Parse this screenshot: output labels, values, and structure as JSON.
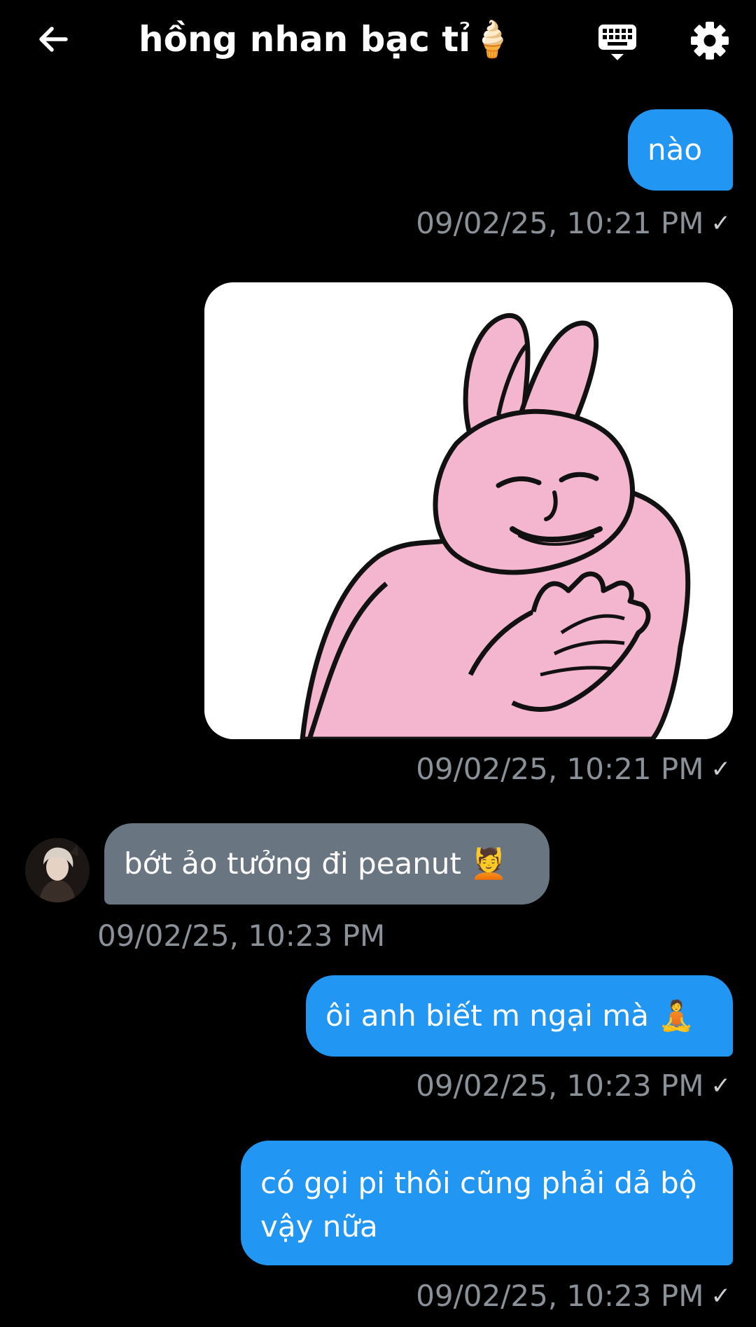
{
  "header": {
    "title": "hồng nhan bạc tỉ🍦",
    "back_icon": "arrow-left-icon",
    "keyboard_icon": "keyboard-icon",
    "settings_icon": "gear-icon"
  },
  "colors": {
    "background": "#000000",
    "outgoing_bubble": "#2196f3",
    "incoming_bubble": "#6a7582",
    "timestamp": "#8a9199"
  },
  "messages": [
    {
      "direction": "out",
      "type": "text",
      "text": "nào",
      "time": "09/02/25, 10:21 PM",
      "status": "✓"
    },
    {
      "direction": "out",
      "type": "image",
      "image": "pink-bunny-sticker",
      "time": "09/02/25, 10:21 PM",
      "status": "✓"
    },
    {
      "direction": "in",
      "type": "text",
      "text": "bớt ảo tưởng đi peanut 💆",
      "time": "09/02/25, 10:23 PM",
      "avatar": "contact-avatar"
    },
    {
      "direction": "out",
      "type": "text",
      "text": "ôi anh biết m ngại mà 🧘",
      "time": "09/02/25, 10:23 PM",
      "status": "✓"
    },
    {
      "direction": "out",
      "type": "text",
      "text": "có gọi pi thôi cũng phải dả bộ vậy nữa",
      "time": "09/02/25, 10:23 PM",
      "status": "✓"
    }
  ]
}
